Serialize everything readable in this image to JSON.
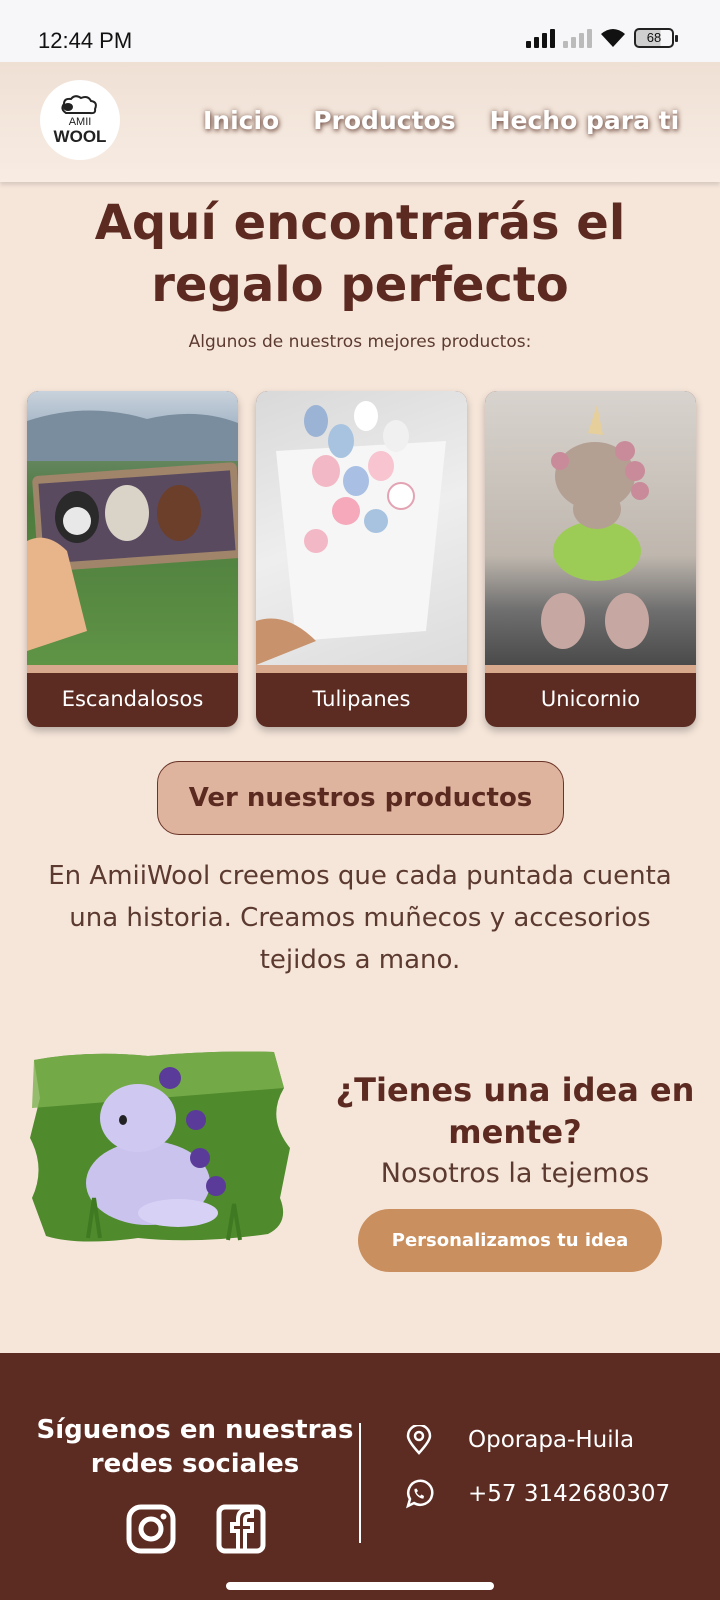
{
  "status_bar": {
    "time": "12:44 PM",
    "battery": "68",
    "icons": [
      "signal-icon",
      "signal-no-sim-icon",
      "wifi-icon",
      "battery-icon"
    ]
  },
  "header": {
    "logo": {
      "line1": "AMII",
      "line2": "WOOL"
    },
    "nav": [
      "Inicio",
      "Productos",
      "Hecho para ti"
    ]
  },
  "hero": {
    "title_line1": "Aquí encontrarás el",
    "title_line2": "regalo perfecto",
    "subtitle": "Algunos de nuestros mejores productos:"
  },
  "products": [
    {
      "label": "Escandalosos"
    },
    {
      "label": "Tulipanes"
    },
    {
      "label": "Unicornio"
    }
  ],
  "cta_button": "Ver nuestros productos",
  "about": "En AmiiWool creemos que cada puntada cuenta una historia. Creamos muñecos y accesorios tejidos a mano.",
  "idea": {
    "title": "¿Tienes una idea en mente?",
    "subtitle": "Nosotros la tejemos",
    "button": "Personalizamos tu idea"
  },
  "footer": {
    "follow": "Síguenos en nuestras redes sociales",
    "social": [
      "instagram-icon",
      "facebook-icon"
    ],
    "location": "Oporapa-Huila",
    "phone": "+57 3142680307"
  },
  "colors": {
    "background": "#f6e6da",
    "brand_brown": "#5c2b22",
    "cta_fill": "#deb49f",
    "idea_button": "#c98f5e"
  }
}
